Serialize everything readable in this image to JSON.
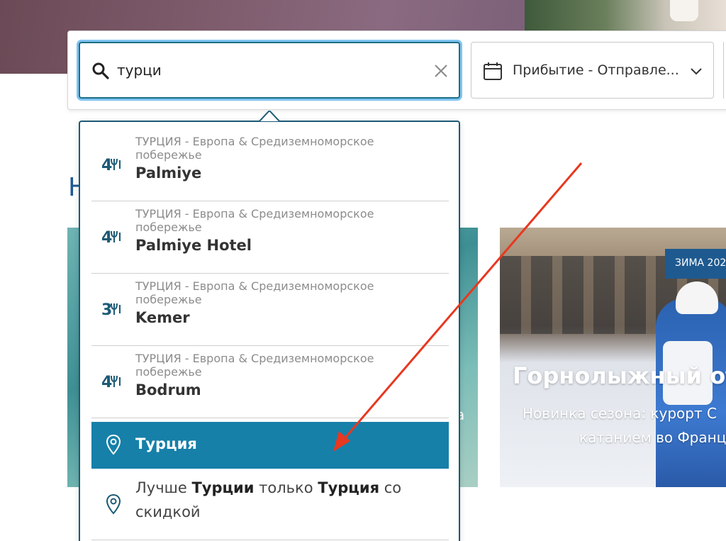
{
  "search": {
    "value": "турци",
    "clear_label": "Очистить"
  },
  "dates": {
    "label": "Прибытие - Отправле..."
  },
  "background": {
    "section_heading_fragment": "Н",
    "left_card_fragment": "a",
    "promo_card": {
      "badge": "ЗИМА 202",
      "title": "Горнолыжный от",
      "subtitle_line1": "Новинка сезона: курорт С",
      "subtitle_line2": "катанием во Франц"
    }
  },
  "suggestions": {
    "resorts": [
      {
        "stars": "4",
        "country": "ТУРЦИЯ",
        "region": " - Европа & Средиземноморское побережье",
        "name": "Palmiye"
      },
      {
        "stars": "4",
        "country": "ТУРЦИЯ",
        "region": " - Европа & Средиземноморское побережье",
        "name": "Palmiye Hotel"
      },
      {
        "stars": "3",
        "country": "ТУРЦИЯ",
        "region": " - Европа & Средиземноморское побережье",
        "name": "Kemer"
      },
      {
        "stars": "4",
        "country": "ТУРЦИЯ",
        "region": " - Европа & Средиземноморское побережье",
        "name": "Bodrum"
      }
    ],
    "destination": {
      "label": "Турция",
      "icon": "location-pin-icon"
    },
    "offer": {
      "line1_a": "Лучше ",
      "line1_b": "Турции",
      "line1_c": " только ",
      "line1_d": "Турция",
      "line1_e": " со",
      "line2": "скидкой",
      "icon": "location-pin-icon"
    }
  },
  "colors": {
    "brand_blue": "#1c5a75",
    "active_row": "#1680a9",
    "focus_glow": "#7ec3f2",
    "annotation_arrow": "#e8381f"
  }
}
